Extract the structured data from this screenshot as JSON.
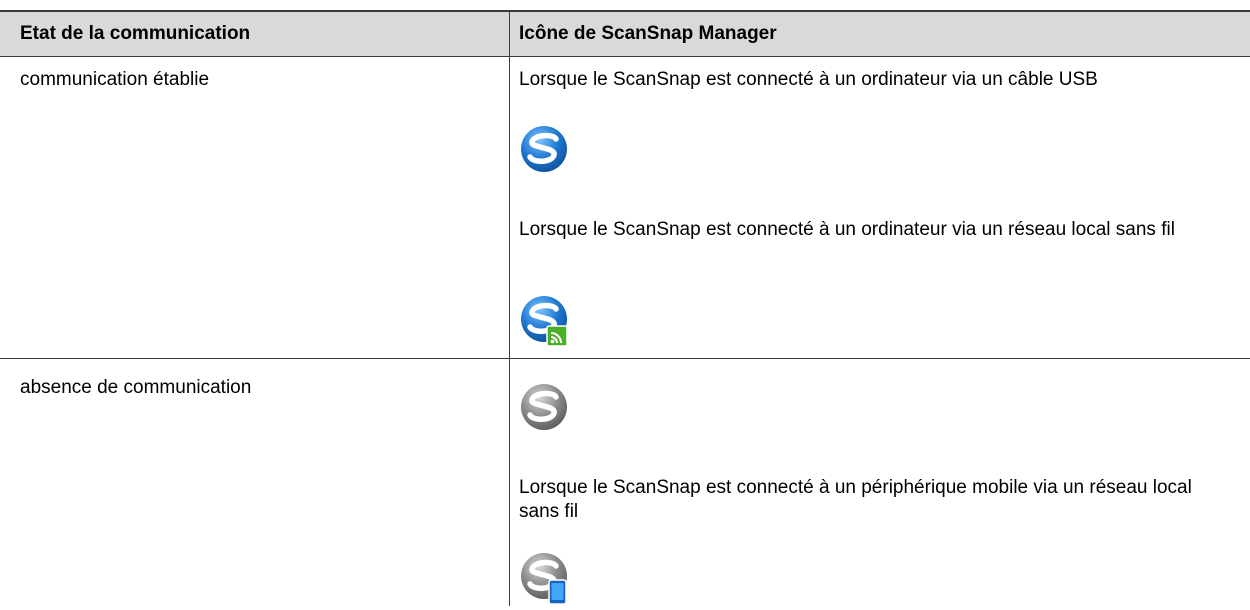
{
  "table": {
    "headers": [
      "Etat de la communication",
      "Icône de ScanSnap Manager"
    ],
    "rows": [
      {
        "state": "communication établie",
        "entries": [
          {
            "caption": "Lorsque le ScanSnap est connecté à un ordinateur via un câble USB",
            "icon": "scansnap-manager-blue-icon"
          },
          {
            "caption": "Lorsque le ScanSnap est connecté à un ordinateur via un réseau local sans fil",
            "icon": "scansnap-manager-blue-wifi-icon"
          }
        ]
      },
      {
        "state": "absence de communication",
        "entries": [
          {
            "caption": "",
            "icon": "scansnap-manager-gray-icon"
          },
          {
            "caption": "Lorsque le ScanSnap est connecté à un périphérique mobile via un réseau local sans fil",
            "icon": "scansnap-manager-gray-mobile-icon"
          }
        ]
      }
    ]
  },
  "colors": {
    "header_bg": "#d9d9d9",
    "border": "#3a3a3a",
    "icon_blue": "#1f78d1",
    "icon_gray": "#8a8a8a",
    "wifi_green": "#4caf2a",
    "mobile_blue": "#1565c0"
  }
}
